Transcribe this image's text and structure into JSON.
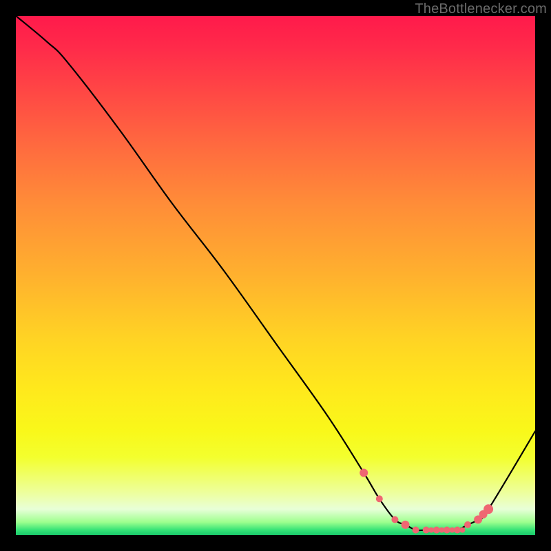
{
  "watermark": "TheBottlenecker.com",
  "colors": {
    "background": "#000000",
    "gradient_top": "#ff1a4b",
    "gradient_bottom": "#19c86a",
    "curve": "#000000",
    "marker": "#ef6672"
  },
  "chart_data": {
    "type": "line",
    "title": "",
    "xlabel": "",
    "ylabel": "",
    "xlim": [
      0,
      100
    ],
    "ylim": [
      0,
      100
    ],
    "series": [
      {
        "name": "bottleneck-curve",
        "x": [
          0,
          6,
          10,
          20,
          30,
          40,
          50,
          60,
          67,
          70,
          73,
          75,
          77,
          79,
          81,
          83,
          85,
          87,
          89,
          91,
          100
        ],
        "values": [
          100,
          95,
          91,
          78,
          64,
          51,
          37,
          23,
          12,
          7,
          3,
          2,
          1,
          1,
          1,
          1,
          1,
          2,
          3,
          5,
          20
        ]
      }
    ],
    "markers": {
      "name": "highlighted-points",
      "x": [
        67,
        70,
        73,
        75,
        77,
        79,
        80,
        81,
        82,
        83,
        84,
        85,
        86,
        87,
        89,
        90,
        91
      ],
      "values": [
        12,
        7,
        3,
        2,
        1,
        1,
        1,
        1,
        1,
        1,
        1,
        1,
        1,
        2,
        3,
        4,
        5
      ],
      "radius": [
        6,
        5,
        5,
        6,
        5,
        5,
        4,
        5,
        4,
        5,
        4,
        5,
        4,
        5,
        6,
        6,
        7
      ]
    }
  }
}
